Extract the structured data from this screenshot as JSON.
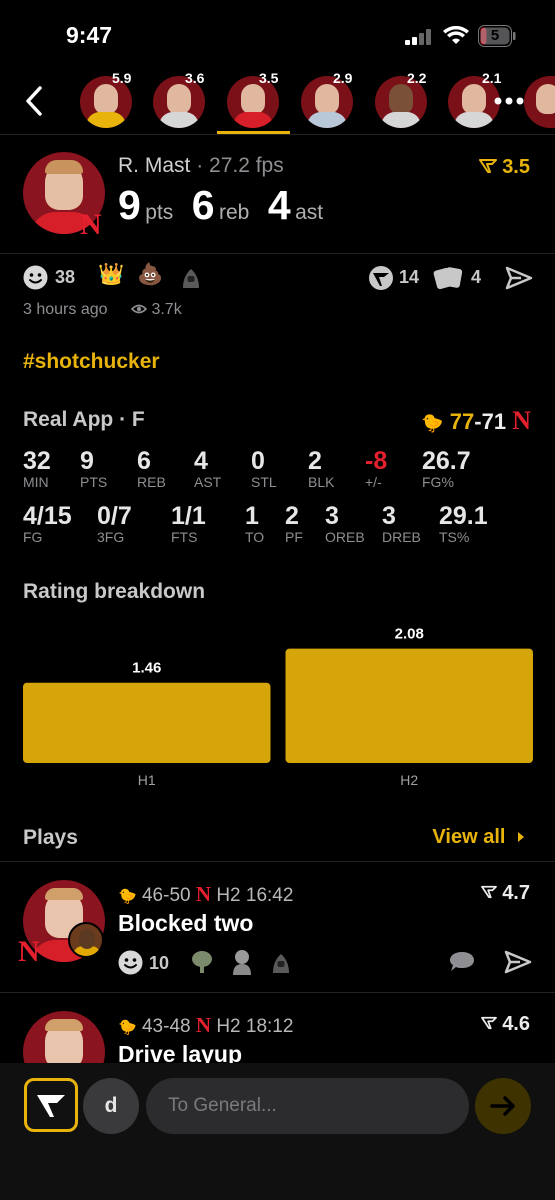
{
  "status_bar": {
    "time": "9:47",
    "battery": "5"
  },
  "player_strip": {
    "players": [
      {
        "rating": "5.9"
      },
      {
        "rating": "3.6"
      },
      {
        "rating": "3.5"
      },
      {
        "rating": "2.9"
      },
      {
        "rating": "2.2"
      },
      {
        "rating": "2.1"
      }
    ]
  },
  "hero": {
    "name": "R. Mast",
    "fps": "· 27.2 fps",
    "rating": "3.5",
    "pts": "9",
    "pts_label": "pts",
    "reb": "6",
    "reb_label": "reb",
    "ast": "4",
    "ast_label": "ast"
  },
  "reactions": {
    "smile_count": "38",
    "react_count": "14",
    "share_count": "4",
    "time_ago": "3 hours ago",
    "views": "3.7k"
  },
  "hashtag": "#shotchucker",
  "game": {
    "label": "Real App · F",
    "score_away": "77",
    "score_sep": "-",
    "score_home": "71",
    "colors": {
      "accent": "#e8b40c",
      "negative": "#e5202e"
    },
    "row1": [
      {
        "value": "32",
        "label": "MIN"
      },
      {
        "value": "9",
        "label": "PTS"
      },
      {
        "value": "6",
        "label": "REB"
      },
      {
        "value": "4",
        "label": "AST"
      },
      {
        "value": "0",
        "label": "STL"
      },
      {
        "value": "2",
        "label": "BLK"
      },
      {
        "value": "-8",
        "label": "+/-"
      },
      {
        "value": "26.7",
        "label": "FG%"
      }
    ],
    "row2": [
      {
        "value": "4/15",
        "label": "FG"
      },
      {
        "value": "0/7",
        "label": "3FG"
      },
      {
        "value": "1/1",
        "label": "FTS"
      },
      {
        "value": "1",
        "label": "TO"
      },
      {
        "value": "2",
        "label": "PF"
      },
      {
        "value": "3",
        "label": "OREB"
      },
      {
        "value": "3",
        "label": "DREB"
      },
      {
        "value": "29.1",
        "label": "TS%"
      }
    ]
  },
  "rating_breakdown_title": "Rating breakdown",
  "chart_data": {
    "type": "bar",
    "categories": [
      "H1",
      "H2"
    ],
    "values": [
      1.46,
      2.08
    ],
    "value_labels": [
      "1.46",
      "2.08"
    ],
    "ylim": [
      0,
      2.2
    ],
    "grid": false,
    "color": "#d6a50a"
  },
  "plays": {
    "title": "Plays",
    "view_all": "View all",
    "items": [
      {
        "away": "46",
        "sep": "-",
        "home": "50",
        "clock": "H2 16:42",
        "title": "Blocked two",
        "rating": "4.7",
        "smile_count": "10"
      },
      {
        "away": "43",
        "sep": "-",
        "home": "48",
        "clock": "H2 18:12",
        "title": "Drive layup",
        "rating": "4.6"
      }
    ]
  },
  "composer": {
    "user_initial": "d",
    "placeholder": "To General..."
  }
}
